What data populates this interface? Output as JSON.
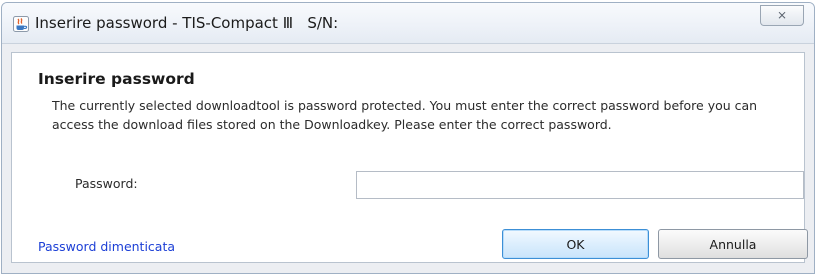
{
  "window": {
    "title": "Inserire password - TIS-Compact Ⅲ   S/N:",
    "close_glyph": "⨯",
    "app_icon": "java-app-icon"
  },
  "dialog": {
    "heading": "Inserire password",
    "description": "The currently selected downloadtool is password protected. You must enter the correct password before you can access the download files stored on the Downloadkey. Please enter the correct password.",
    "password_label": "Password:",
    "password_value": "",
    "password_placeholder": ""
  },
  "footer": {
    "forgot_link": "Password dimenticata",
    "ok_label": "OK",
    "cancel_label": "Annulla"
  },
  "colors": {
    "link": "#1c3fd6",
    "default_button_border": "#3c8fd6",
    "panel_background": "#ffffff",
    "window_background": "#eceef2"
  }
}
